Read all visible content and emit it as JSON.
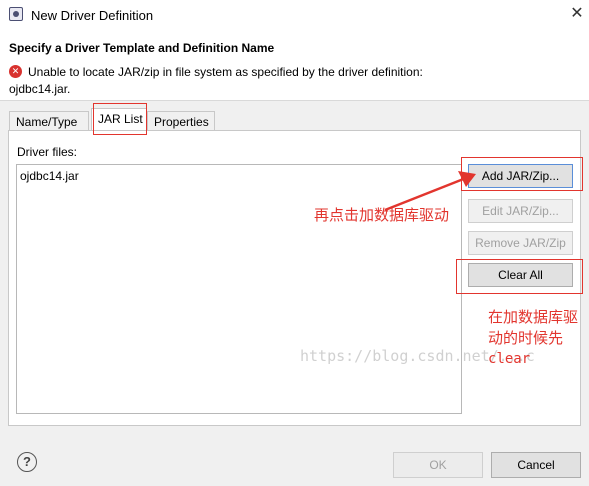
{
  "window": {
    "title": "New Driver Definition",
    "close_glyph": "✕"
  },
  "header": {
    "heading": "Specify a Driver Template and Definition Name",
    "error_icon": "error-icon",
    "error_line1": "Unable to locate JAR/zip in file system as specified by the driver definition:",
    "error_line2": "ojdbc14.jar."
  },
  "tabs": [
    {
      "label": "Name/Type",
      "selected": false
    },
    {
      "label": "JAR List",
      "selected": true
    },
    {
      "label": "Properties",
      "selected": false
    }
  ],
  "jar_list": {
    "driver_files_label": "Driver files:",
    "files": [
      "ojdbc14.jar"
    ],
    "buttons": {
      "add": "Add JAR/Zip...",
      "edit": "Edit JAR/Zip...",
      "remove": "Remove JAR/Zip",
      "clear": "Clear All"
    }
  },
  "footer": {
    "help_glyph": "?",
    "ok": "OK",
    "cancel": "Cancel"
  },
  "watermark": "https://blog.csdn.net/...c",
  "annotations": {
    "add_note": "再点击加数据库驱动",
    "clear_note_line1": "在加数据库驱",
    "clear_note_line2": "动的时候先",
    "clear_note_line3": "clear",
    "color": "#e2352e"
  }
}
